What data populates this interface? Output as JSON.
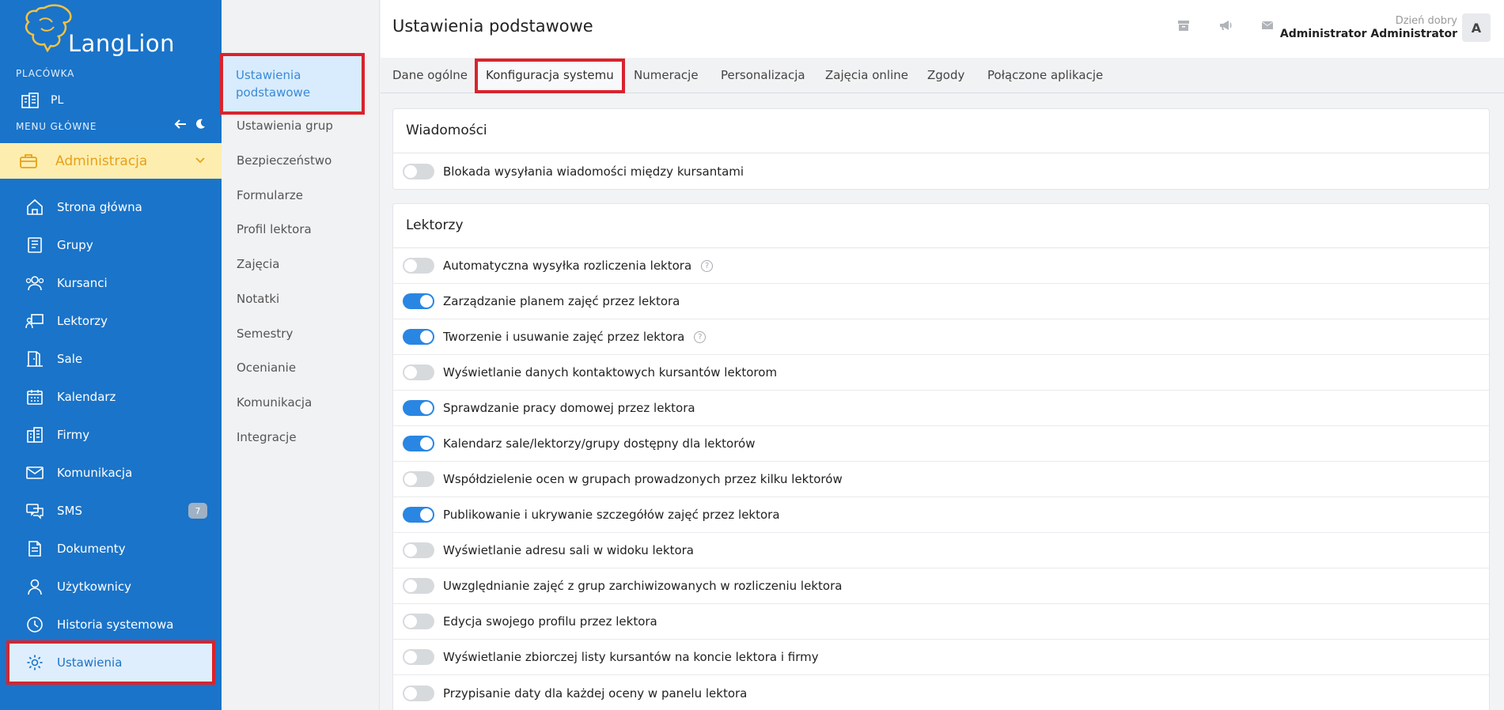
{
  "brand": {
    "name": "LangLion"
  },
  "colors": {
    "sidebar": "#1a74c9",
    "accent": "#2a86e3",
    "highlight": "#d9232e",
    "admin_bg": "#fdeeb0",
    "admin_text": "#e8a018"
  },
  "sidebar": {
    "placowka_label": "PLACÓWKA",
    "placowka_value": "PL",
    "menu_label": "MENU GŁÓWNE",
    "admin_label": "Administracja",
    "items": [
      {
        "label": "Strona główna",
        "icon": "home-icon"
      },
      {
        "label": "Grupy",
        "icon": "book-icon"
      },
      {
        "label": "Kursanci",
        "icon": "users-icon"
      },
      {
        "label": "Lektorzy",
        "icon": "teacher-icon"
      },
      {
        "label": "Sale",
        "icon": "door-icon"
      },
      {
        "label": "Kalendarz",
        "icon": "calendar-icon"
      },
      {
        "label": "Firmy",
        "icon": "building-icon"
      },
      {
        "label": "Komunikacja",
        "icon": "envelope-icon"
      },
      {
        "label": "SMS",
        "icon": "chat-icon",
        "badge": "7"
      },
      {
        "label": "Dokumenty",
        "icon": "document-icon"
      },
      {
        "label": "Użytkownicy",
        "icon": "user-icon"
      },
      {
        "label": "Historia systemowa",
        "icon": "clock-icon"
      },
      {
        "label": "Ustawienia",
        "icon": "gear-icon"
      }
    ]
  },
  "subnav": {
    "active": "Ustawienia podstawowe",
    "items": [
      "Ustawienia grup",
      "Bezpieczeństwo",
      "Formularze",
      "Profil lektora",
      "Zajęcia",
      "Notatki",
      "Semestry",
      "Ocenianie",
      "Komunikacja",
      "Integracje"
    ]
  },
  "header": {
    "title": "Ustawienia podstawowe",
    "greeting": "Dzień dobry",
    "user": "Administrator Administrator",
    "avatar": "A"
  },
  "tabs": [
    "Dane ogólne",
    "Konfiguracja systemu",
    "Numeracje",
    "Personalizacja",
    "Zajęcia online",
    "Zgody",
    "Połączone aplikacje"
  ],
  "sections": {
    "wiadomosci": {
      "title": "Wiadomości",
      "rows": [
        {
          "label": "Blokada wysyłania wiadomości między kursantami",
          "on": false
        }
      ]
    },
    "lektorzy": {
      "title": "Lektorzy",
      "rows": [
        {
          "label": "Automatyczna wysyłka rozliczenia lektora",
          "on": false,
          "help": true
        },
        {
          "label": "Zarządzanie planem zajęć przez lektora",
          "on": true
        },
        {
          "label": "Tworzenie i usuwanie zajęć przez lektora",
          "on": true,
          "help": true
        },
        {
          "label": "Wyświetlanie danych kontaktowych kursantów lektorom",
          "on": false
        },
        {
          "label": "Sprawdzanie pracy domowej przez lektora",
          "on": true
        },
        {
          "label": "Kalendarz sale/lektorzy/grupy dostępny dla lektorów",
          "on": true
        },
        {
          "label": "Współdzielenie ocen w grupach prowadzonych przez kilku lektorów",
          "on": false
        },
        {
          "label": "Publikowanie i ukrywanie szczegółów zajęć przez lektora",
          "on": true
        },
        {
          "label": "Wyświetlanie adresu sali w widoku lektora",
          "on": false
        },
        {
          "label": "Uwzględnianie zajęć z grup zarchiwizowanych w rozliczeniu lektora",
          "on": false
        },
        {
          "label": "Edycja swojego profilu przez lektora",
          "on": false
        },
        {
          "label": "Wyświetlanie zbiorczej listy kursantów na koncie lektora i firmy",
          "on": false
        },
        {
          "label": "Przypisanie daty dla każdej oceny w panelu lektora",
          "on": false
        }
      ]
    }
  }
}
